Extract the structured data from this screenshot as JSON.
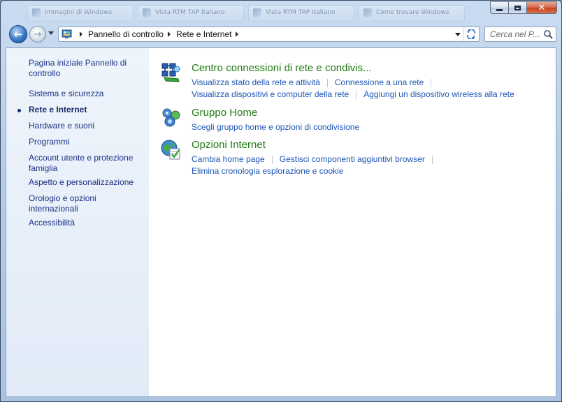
{
  "window": {
    "background_tabs": [
      "Immagini di Windows",
      "Vista RTM TAP Italiano",
      "Vista RTM TAP Italiano",
      "Come trovare Windows"
    ],
    "caption": {
      "minimize": "minimize-icon",
      "maximize": "maximize-icon",
      "close": "close-icon"
    }
  },
  "navbar": {
    "breadcrumbs": [
      "Pannello di controllo",
      "Rete e Internet"
    ],
    "search_placeholder": "Cerca nel P..."
  },
  "sidebar": {
    "home_link": "Pagina iniziale Pannello di controllo",
    "items": [
      {
        "label": "Sistema e sicurezza",
        "current": false
      },
      {
        "label": "Rete e Internet",
        "current": true
      },
      {
        "label": "Hardware e suoni",
        "current": false
      },
      {
        "label": "Programmi",
        "current": false
      },
      {
        "label": "Account utente e protezione famiglia",
        "current": false
      },
      {
        "label": "Aspetto e personalizzazione",
        "current": false
      },
      {
        "label": "Orologio e opzioni internazionali",
        "current": false
      },
      {
        "label": "Accessibilità",
        "current": false
      }
    ]
  },
  "sections": [
    {
      "title": "Centro connessioni di rete e condivis...",
      "icon": "network-center-icon",
      "links_row1": [
        "Visualizza stato della rete e attività",
        "Connessione a una rete"
      ],
      "links_row2": [
        "Visualizza dispositivi e computer della rete",
        "Aggiungi un dispositivo wireless alla rete"
      ]
    },
    {
      "title": "Gruppo Home",
      "icon": "homegroup-icon",
      "links_row1": [
        "Scegli gruppo home e opzioni di condivisione"
      ]
    },
    {
      "title": "Opzioni Internet",
      "icon": "internet-options-icon",
      "links_row1": [
        "Cambia home page",
        "Gestisci componenti aggiuntivi browser"
      ],
      "links_row2": [
        "Elimina cronologia esplorazione e cookie"
      ]
    }
  ],
  "colors": {
    "link": "#1d56b6",
    "section_title": "#1e7c12",
    "sidebar_link": "#1e3287"
  }
}
